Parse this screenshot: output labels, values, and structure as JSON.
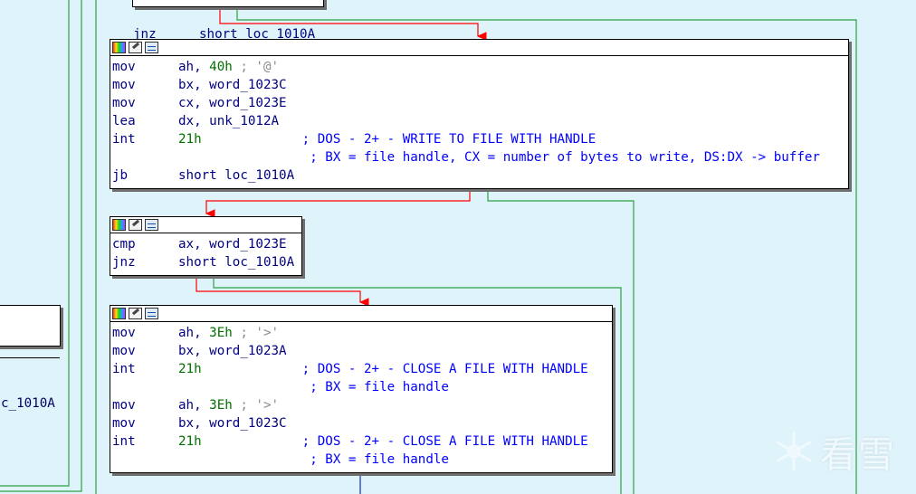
{
  "top_stub": {
    "mnemonic": "jnz",
    "operand": "short loc_1010A"
  },
  "left_stub": {
    "text": "c_1010A"
  },
  "blocks": [
    {
      "lines": [
        {
          "m": "mov",
          "ops": [
            {
              "t": "ah, ",
              "c": "ops"
            },
            {
              "t": "40h",
              "c": "num"
            },
            {
              "t": " ; '@'",
              "c": "chr"
            }
          ]
        },
        {
          "m": "mov",
          "ops": [
            {
              "t": "bx, word_1023C",
              "c": "ops"
            }
          ]
        },
        {
          "m": "mov",
          "ops": [
            {
              "t": "cx, word_1023E",
              "c": "ops"
            }
          ]
        },
        {
          "m": "lea",
          "ops": [
            {
              "t": "dx, unk_1012A",
              "c": "ops"
            }
          ]
        },
        {
          "m": "int",
          "ops": [
            {
              "t": "21h",
              "c": "num"
            },
            {
              "t": "             ; DOS - 2+ - WRITE TO FILE WITH HANDLE",
              "c": "cmt"
            }
          ]
        },
        {
          "m": "",
          "ops": [
            {
              "t": "                 ; BX = file handle, CX = number of bytes to write, DS:DX -> buffer",
              "c": "cmt"
            }
          ]
        },
        {
          "m": "jb",
          "ops": [
            {
              "t": "short loc_1010A",
              "c": "ops"
            }
          ]
        }
      ]
    },
    {
      "lines": [
        {
          "m": "cmp",
          "ops": [
            {
              "t": "ax, word_1023E",
              "c": "ops"
            }
          ]
        },
        {
          "m": "jnz",
          "ops": [
            {
              "t": "short loc_1010A",
              "c": "ops"
            }
          ]
        }
      ]
    },
    {
      "lines": [
        {
          "m": "mov",
          "ops": [
            {
              "t": "ah, ",
              "c": "ops"
            },
            {
              "t": "3Eh",
              "c": "num"
            },
            {
              "t": " ; '>'",
              "c": "chr"
            }
          ]
        },
        {
          "m": "mov",
          "ops": [
            {
              "t": "bx, word_1023A",
              "c": "ops"
            }
          ]
        },
        {
          "m": "int",
          "ops": [
            {
              "t": "21h",
              "c": "num"
            },
            {
              "t": "             ; DOS - 2+ - CLOSE A FILE WITH HANDLE",
              "c": "cmt"
            }
          ]
        },
        {
          "m": "",
          "ops": [
            {
              "t": "                 ; BX = file handle",
              "c": "cmt"
            }
          ]
        },
        {
          "m": "mov",
          "ops": [
            {
              "t": "ah, ",
              "c": "ops"
            },
            {
              "t": "3Eh",
              "c": "num"
            },
            {
              "t": " ; '>'",
              "c": "chr"
            }
          ]
        },
        {
          "m": "mov",
          "ops": [
            {
              "t": "bx, word_1023C",
              "c": "ops"
            }
          ]
        },
        {
          "m": "int",
          "ops": [
            {
              "t": "21h",
              "c": "num"
            },
            {
              "t": "             ; DOS - 2+ - CLOSE A FILE WITH HANDLE",
              "c": "cmt"
            }
          ]
        },
        {
          "m": "",
          "ops": [
            {
              "t": "                 ; BX = file handle",
              "c": "cmt"
            }
          ]
        }
      ]
    }
  ],
  "watermark": {
    "text": "看雪"
  },
  "colors": {
    "background": "#dff3fb",
    "branch_taken": "#ff0000",
    "branch_fallthrough": "#2ea043",
    "flow": "#1e3fc0"
  }
}
